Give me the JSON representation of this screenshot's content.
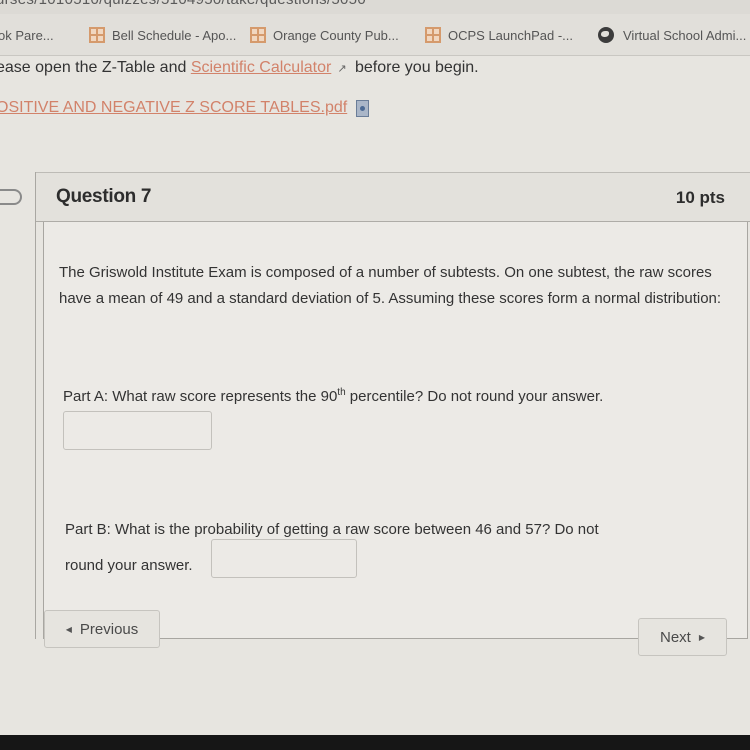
{
  "browser": {
    "url_fragment": "urses/1010510/quizzes/5104950/take/questions/5050",
    "bookmarks": [
      {
        "label": "ok Pare...",
        "icon": "none"
      },
      {
        "label": "Bell Schedule - Apo...",
        "icon": "grid-icon"
      },
      {
        "label": "Orange County Pub...",
        "icon": "grid-icon"
      },
      {
        "label": "OCPS LaunchPad -...",
        "icon": "grid-icon"
      },
      {
        "label": "Virtual School Admi...",
        "icon": "globe-icon"
      }
    ]
  },
  "intro": {
    "text_before": "ease open the Z-Table and ",
    "calculator_link": "Scientific Calculator",
    "text_after": " before you begin.",
    "pdf_link": "OSITIVE AND NEGATIVE Z SCORE TABLES.pdf"
  },
  "question": {
    "title": "Question 7",
    "points": "10 pts",
    "stem": "The Griswold Institute Exam is composed of a number of subtests. On one subtest, the raw scores have a mean of 49 and a standard deviation of 5. Assuming these scores form a normal distribution:",
    "part_a": {
      "text_before": "Part A: What raw score represents the 90",
      "superscript": "th",
      "text_after": " percentile? Do not round your answer.",
      "answer_value": ""
    },
    "part_b": {
      "text_line1": "Part B: What is the probability of getting a raw score between 46 and 57?  Do not",
      "text_line2": "round your answer.",
      "answer_value": ""
    }
  },
  "nav": {
    "previous_label": "Previous",
    "next_label": "Next"
  }
}
